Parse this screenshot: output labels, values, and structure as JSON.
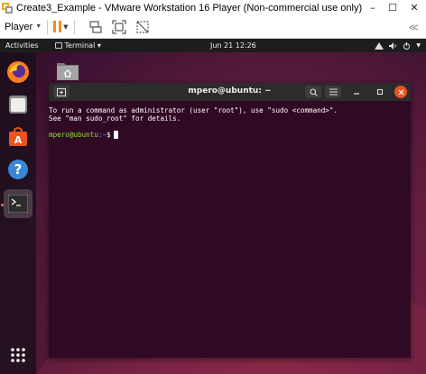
{
  "window": {
    "title": "Create3_Example - VMware Workstation 16 Player (Non-commercial use only)",
    "controls": [
      "–",
      "☐",
      "✕"
    ]
  },
  "toolbar": {
    "player_label": "Player",
    "right_glyph": "≪"
  },
  "topbar": {
    "activities": "Activities",
    "app_menu": "Terminal ▾",
    "clock": "Jun 21  12:26"
  },
  "dock": {
    "items": [
      "firefox-icon",
      "files-icon",
      "software-icon",
      "help-icon",
      "terminal-icon",
      "show-apps-icon"
    ]
  },
  "terminal": {
    "title": "mpero@ubuntu: ~",
    "lines": [
      "To run a command as administrator (user \"root\"), use \"sudo <command>\".",
      "See \"man sudo_root\" for details."
    ],
    "prompt_user": "mpero@ubuntu",
    "prompt_path": ":~",
    "prompt_symbol": "$"
  },
  "colors": {
    "terminal_bg": "#300a24",
    "accent": "#e95420",
    "pause": "#f58a1f"
  }
}
